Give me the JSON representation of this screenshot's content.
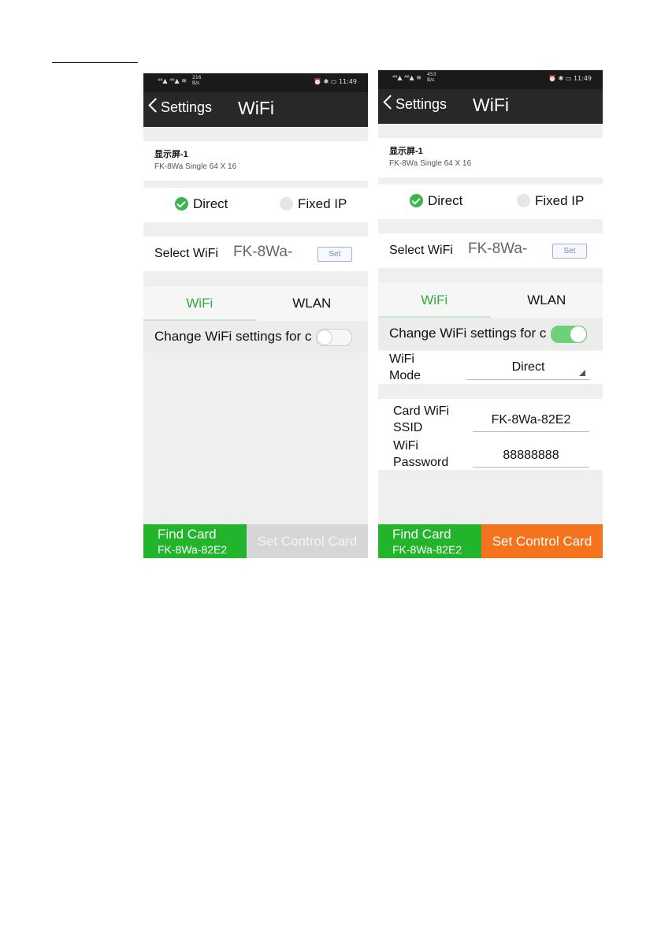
{
  "left": {
    "status": {
      "signal": "⁴⁶▲ ⁴⁶▲ ≋",
      "speed_value": "216",
      "speed_unit": "B/s",
      "right": "⏰ ✱ ▭ 11:49"
    },
    "nav": {
      "back_label": "Settings",
      "title": "WiFi"
    },
    "device": {
      "name": "显示屏-1",
      "info": "FK-8Wa   Single   64 X 16"
    },
    "mode": {
      "direct": "Direct",
      "fixed_ip": "Fixed IP",
      "selected": "Direct"
    },
    "select_wifi": {
      "label": "Select WiFi",
      "value": "FK-8Wa-",
      "button": "Set"
    },
    "tabs": {
      "wifi": "WiFi",
      "wlan": "WLAN",
      "active": "WiFi"
    },
    "change": {
      "label": "Change WiFi settings for c",
      "toggle_on": false
    },
    "bottom": {
      "find_title": "Find Card",
      "find_sub": "FK-8Wa-82E2",
      "set_label": "Set Control Card",
      "set_enabled": false
    }
  },
  "right": {
    "status": {
      "signal": "⁴⁶▲ ⁴⁶▲ ≋",
      "speed_value": "453",
      "speed_unit": "B/s",
      "right": "⏰ ✱ ▭ 11:49"
    },
    "nav": {
      "back_label": "Settings",
      "title": "WiFi"
    },
    "device": {
      "name": "显示屏-1",
      "info": "FK-8Wa   Single   64 X 16"
    },
    "mode": {
      "direct": "Direct",
      "fixed_ip": "Fixed IP",
      "selected": "Direct"
    },
    "select_wifi": {
      "label": "Select WiFi",
      "value": "FK-8Wa-",
      "button": "Set"
    },
    "tabs": {
      "wifi": "WiFi",
      "wlan": "WLAN",
      "active": "WiFi"
    },
    "change": {
      "label": "Change WiFi settings for c",
      "toggle_on": true
    },
    "wifi_mode": {
      "label_line1": "WiFi",
      "label_line2": "Mode",
      "value": "Direct"
    },
    "ssid": {
      "label_line1": "Card WiFi",
      "label_line2": "SSID",
      "value": "FK-8Wa-82E2"
    },
    "password": {
      "label_line1": "WiFi",
      "label_line2": "Password",
      "value": "88888888"
    },
    "bottom": {
      "find_title": "Find Card",
      "find_sub": "FK-8Wa-82E2",
      "set_label": "Set Control Card",
      "set_enabled": true
    }
  },
  "colors": {
    "green": "#22b52c",
    "tab_green": "#2bae3a",
    "orange": "#f5731d",
    "toggle_on": "#6ed17a",
    "nav_bg": "#282828"
  }
}
